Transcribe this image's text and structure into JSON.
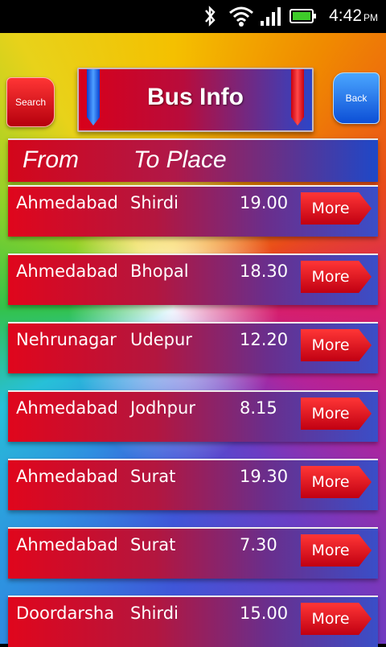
{
  "status_bar": {
    "time": "4:42",
    "ampm": "PM",
    "icons": [
      "bluetooth-icon",
      "wifi-icon",
      "signal-icon",
      "battery-icon"
    ]
  },
  "header": {
    "title": "Bus Info",
    "search_label": "Search",
    "back_label": "Back"
  },
  "columns": {
    "from": "From",
    "to": "To Place"
  },
  "rows": [
    {
      "from": "Ahmedabad",
      "to": "Shirdi",
      "time": "19.00",
      "more": "More"
    },
    {
      "from": "Ahmedabad",
      "to": "Bhopal",
      "time": "18.30",
      "more": "More"
    },
    {
      "from": "Nehrunagar",
      "to": "Udepur",
      "time": "12.20",
      "more": "More"
    },
    {
      "from": "Ahmedabad",
      "to": "Jodhpur",
      "time": "8.15",
      "more": "More"
    },
    {
      "from": "Ahmedabad",
      "to": "Surat",
      "time": "19.30",
      "more": "More"
    },
    {
      "from": "Ahmedabad",
      "to": "Surat",
      "time": "7.30",
      "more": "More"
    },
    {
      "from": "Doordarsha",
      "to": "Shirdi",
      "time": "15.00",
      "more": "More"
    }
  ]
}
